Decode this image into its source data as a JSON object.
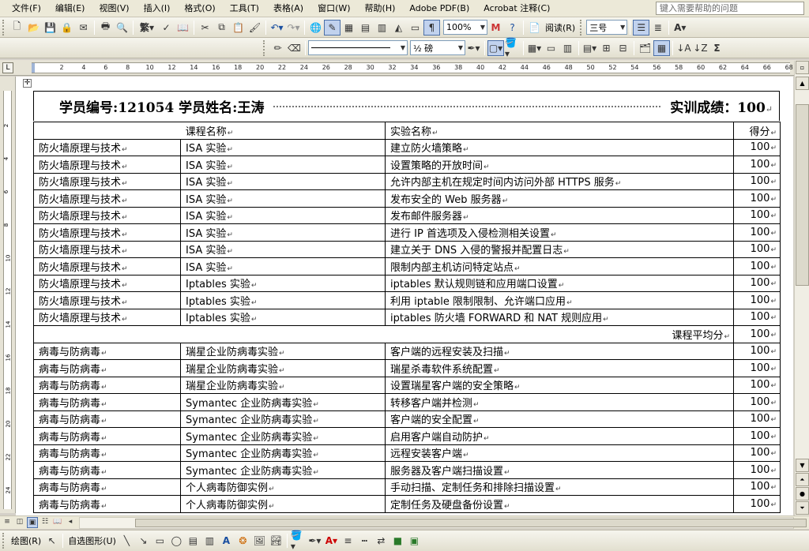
{
  "menubar": {
    "items": [
      "文件(F)",
      "编辑(E)",
      "视图(V)",
      "插入(I)",
      "格式(O)",
      "工具(T)",
      "表格(A)",
      "窗口(W)",
      "帮助(H)",
      "Adobe PDF(B)",
      "Acrobat 注释(C)"
    ],
    "help_placeholder": "键入需要帮助的问题"
  },
  "toolbar1": {
    "zoom": "100%",
    "read_label": "阅读(R)",
    "font_size": "三号"
  },
  "toolbar2": {
    "line_weight": "½ 磅"
  },
  "ruler": {
    "ticks": [
      "2",
      "4",
      "6",
      "8",
      "10",
      "12",
      "14",
      "16",
      "18",
      "20",
      "22",
      "24",
      "26",
      "28",
      "30",
      "32",
      "34",
      "36",
      "38",
      "40",
      "42",
      "44",
      "46",
      "48",
      "50",
      "52",
      "54",
      "56",
      "58",
      "60",
      "62",
      "64",
      "66",
      "68"
    ],
    "vticks": [
      "2",
      "4",
      "6",
      "8",
      "10",
      "12",
      "14",
      "16",
      "18",
      "20",
      "22",
      "24"
    ]
  },
  "document": {
    "header_left": "学员编号:121054  学员姓名:王涛",
    "header_right": "实训成绩：100",
    "columns": {
      "course": "课程名称",
      "lab": "实验名称",
      "score": "得分"
    },
    "section1_rows": [
      {
        "course": "防火墙原理与技术",
        "lab": "ISA 实验",
        "task": "建立防火墙策略",
        "score": "100"
      },
      {
        "course": "防火墙原理与技术",
        "lab": "ISA 实验",
        "task": "设置策略的开放时间",
        "score": "100"
      },
      {
        "course": "防火墙原理与技术",
        "lab": "ISA 实验",
        "task": "允许内部主机在规定时间内访问外部 HTTPS 服务",
        "score": "100"
      },
      {
        "course": "防火墙原理与技术",
        "lab": "ISA 实验",
        "task": "发布安全的 Web 服务器",
        "score": "100"
      },
      {
        "course": "防火墙原理与技术",
        "lab": "ISA 实验",
        "task": "发布邮件服务器",
        "score": "100"
      },
      {
        "course": "防火墙原理与技术",
        "lab": "ISA 实验",
        "task": "进行 IP 首选项及入侵检测相关设置",
        "score": "100"
      },
      {
        "course": "防火墙原理与技术",
        "lab": "ISA 实验",
        "task": "建立关于 DNS 入侵的警报并配置日志",
        "score": "100"
      },
      {
        "course": "防火墙原理与技术",
        "lab": "ISA 实验",
        "task": "限制内部主机访问特定站点",
        "score": "100"
      },
      {
        "course": "防火墙原理与技术",
        "lab": "Iptables 实验",
        "task": "iptables 默认规则链和应用端口设置",
        "score": "100"
      },
      {
        "course": "防火墙原理与技术",
        "lab": "Iptables 实验",
        "task": "利用 iptable 限制限制、允许端口应用",
        "score": "100"
      },
      {
        "course": "防火墙原理与技术",
        "lab": "Iptables 实验",
        "task": "iptables 防火墙 FORWARD 和 NAT 规则应用",
        "score": "100"
      }
    ],
    "avg_label": "课程平均分",
    "avg_score": "100",
    "section2_rows": [
      {
        "course": "病毒与防病毒",
        "lab": "瑞星企业防病毒实验",
        "task": "客户端的远程安装及扫描",
        "score": "100"
      },
      {
        "course": "病毒与防病毒",
        "lab": "瑞星企业防病毒实验",
        "task": "瑞星杀毒软件系统配置",
        "score": "100"
      },
      {
        "course": "病毒与防病毒",
        "lab": "瑞星企业防病毒实验",
        "task": "设置瑞星客户端的安全策略",
        "score": "100"
      },
      {
        "course": "病毒与防病毒",
        "lab": "Symantec 企业防病毒实验",
        "task": "转移客户端并检测",
        "score": "100"
      },
      {
        "course": "病毒与防病毒",
        "lab": "Symantec 企业防病毒实验",
        "task": "客户端的安全配置",
        "score": "100"
      },
      {
        "course": "病毒与防病毒",
        "lab": "Symantec 企业防病毒实验",
        "task": "启用客户端自动防护",
        "score": "100"
      },
      {
        "course": "病毒与防病毒",
        "lab": "Symantec 企业防病毒实验",
        "task": "远程安装客户端",
        "score": "100"
      },
      {
        "course": "病毒与防病毒",
        "lab": "Symantec 企业防病毒实验",
        "task": "服务器及客户端扫描设置",
        "score": "100"
      },
      {
        "course": "病毒与防病毒",
        "lab": "个人病毒防御实例",
        "task": "手动扫描、定制任务和排除扫描设置",
        "score": "100"
      },
      {
        "course": "病毒与防病毒",
        "lab": "个人病毒防御实例",
        "task": "定制任务及硬盘备份设置",
        "score": "100"
      }
    ]
  },
  "draw_toolbar": {
    "draw_label": "绘图(R)",
    "autoshape_label": "自选图形(U)"
  },
  "colors": {
    "chrome": "#ece9d8",
    "active_button": "#c1d2ee",
    "table_border": "#000000"
  }
}
